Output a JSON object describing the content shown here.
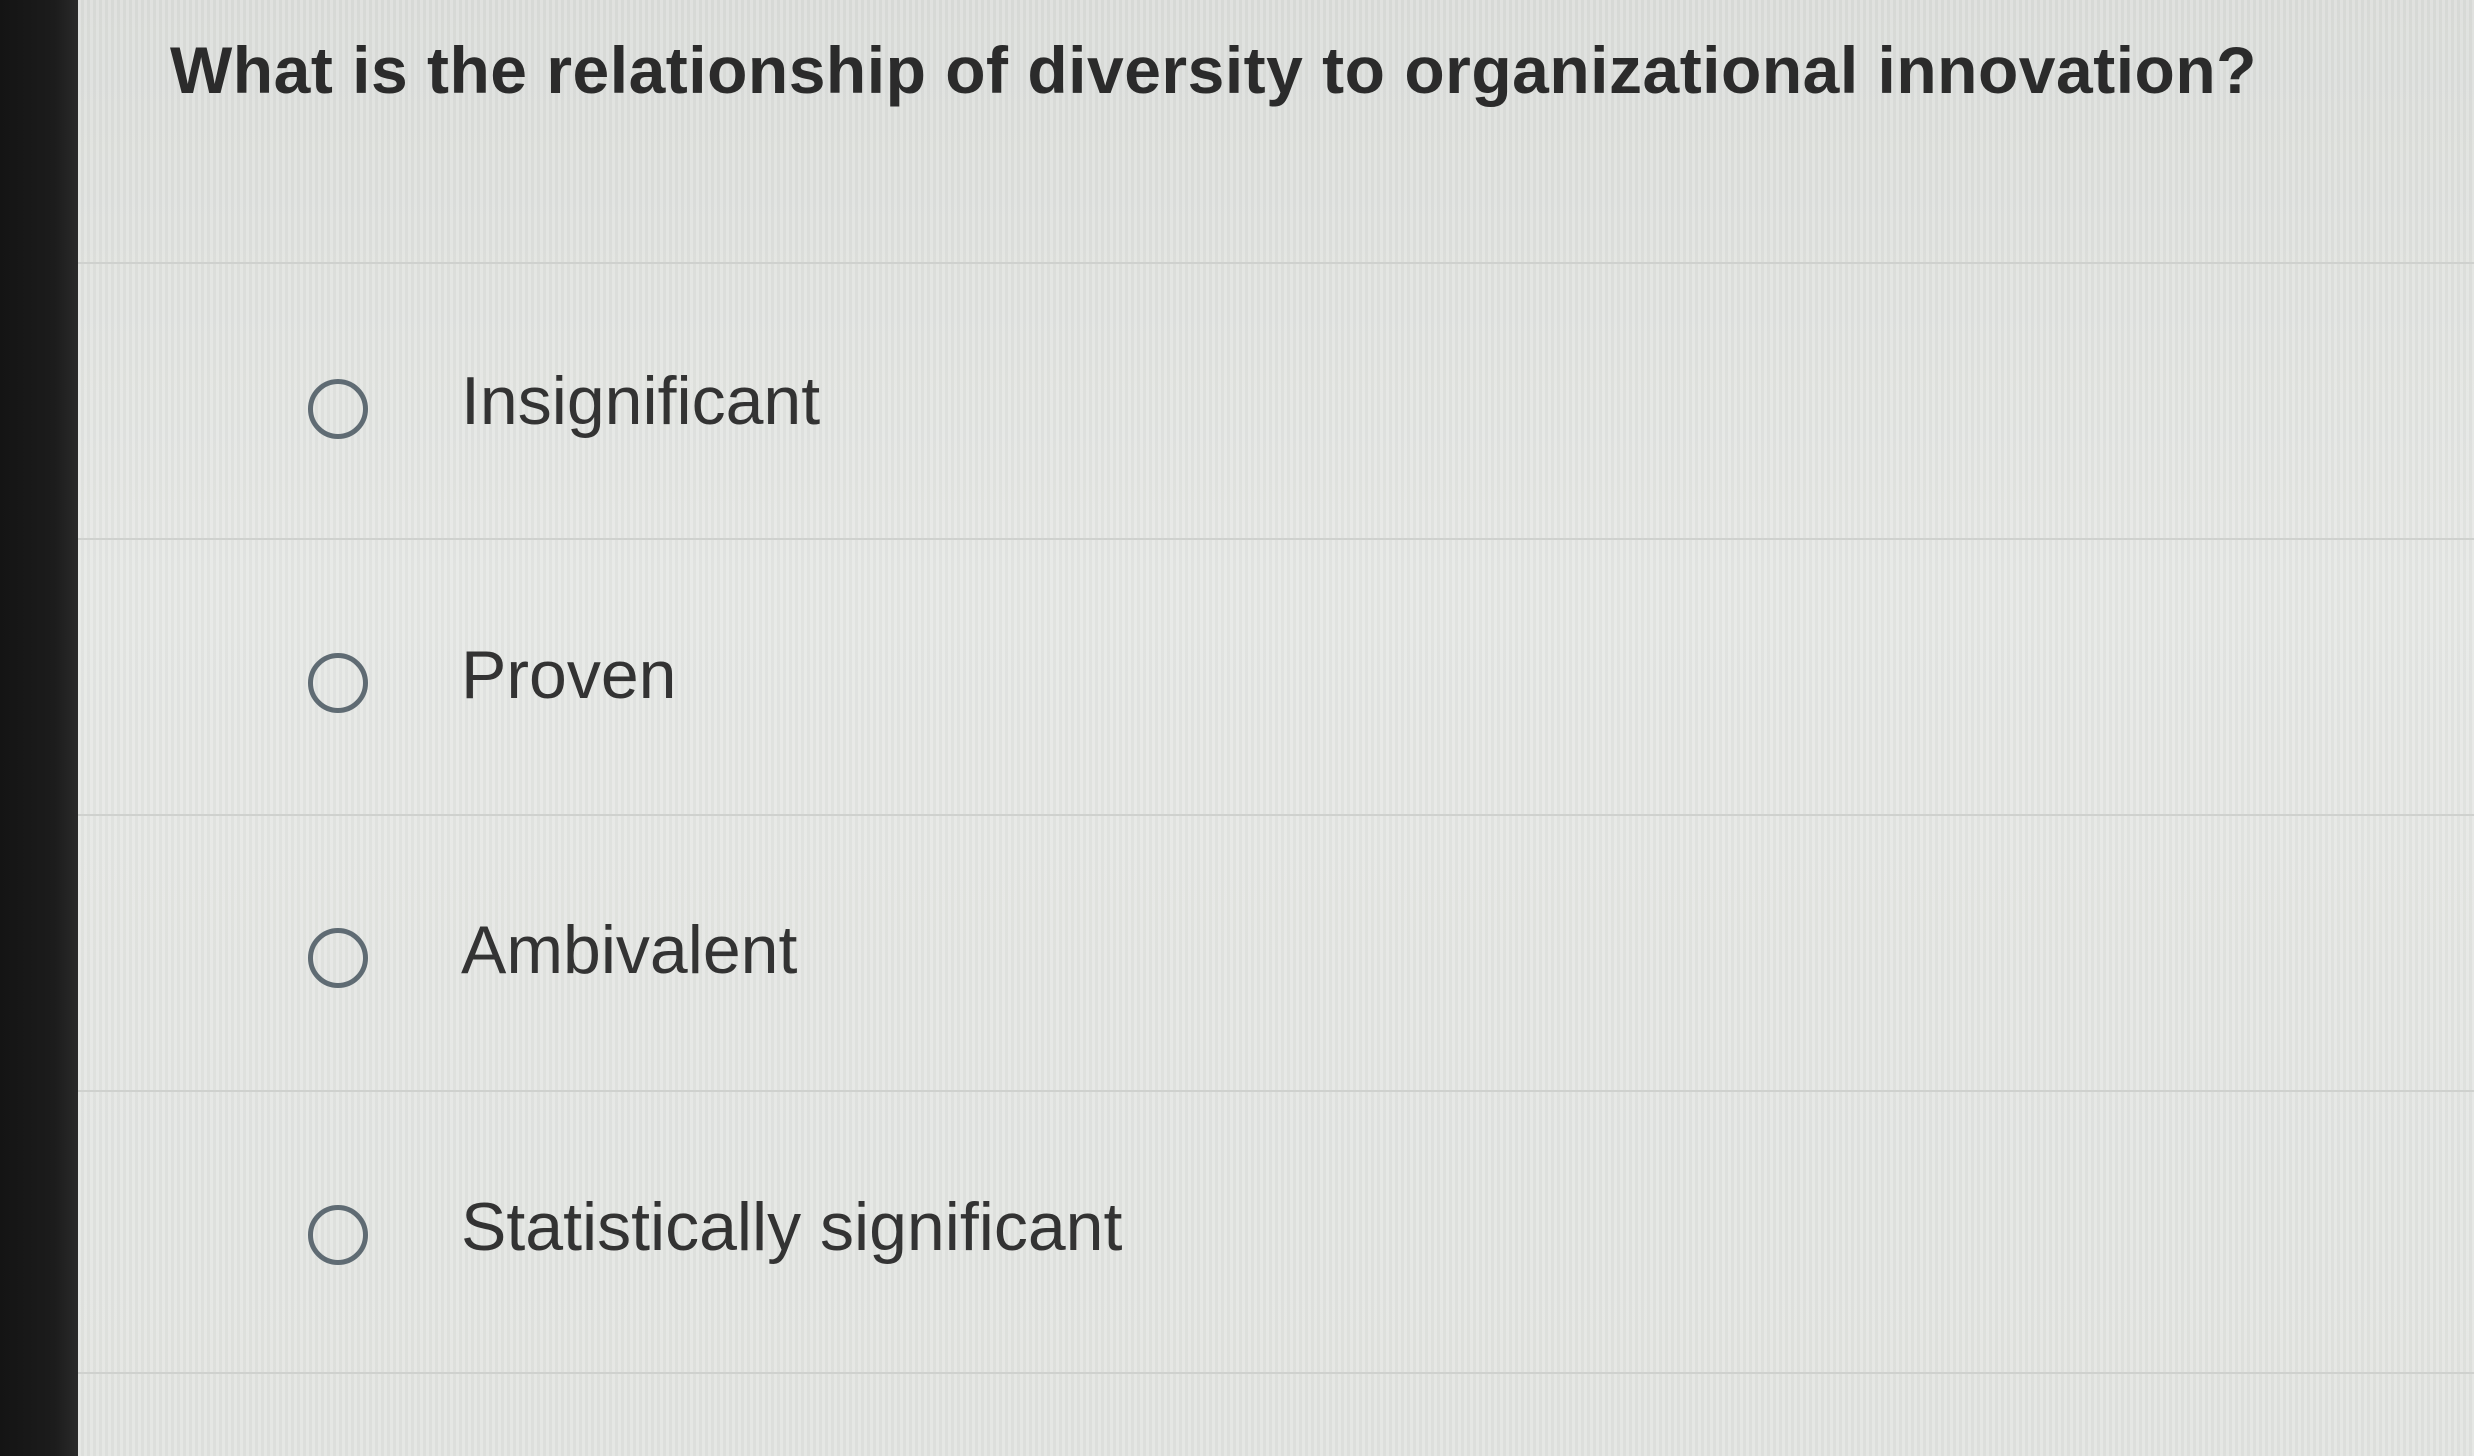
{
  "question": {
    "text": "What is the relationship of diversity to organizational innovation?"
  },
  "options": [
    {
      "label": "Insignificant",
      "selected": false
    },
    {
      "label": "Proven",
      "selected": false
    },
    {
      "label": "Ambivalent",
      "selected": false
    },
    {
      "label": "Statistically significant",
      "selected": false
    }
  ],
  "colors": {
    "background": "#e4e6e3",
    "text": "#2b2b2b",
    "radio_border": "#5f6b73",
    "divider": "#cfd1ce"
  }
}
